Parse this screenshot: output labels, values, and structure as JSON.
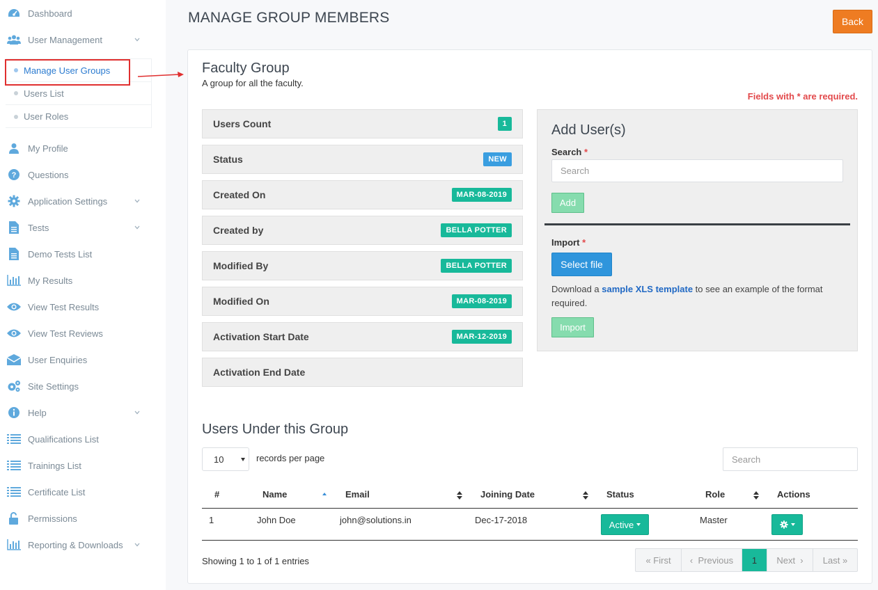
{
  "sidebar": {
    "items": [
      {
        "label": "Dashboard",
        "icon": "dashboard-icon"
      },
      {
        "label": "User Management",
        "icon": "users-icon",
        "expandable": true
      },
      {
        "label": "My Profile",
        "icon": "user-icon"
      },
      {
        "label": "Questions",
        "icon": "question-icon"
      },
      {
        "label": "Application Settings",
        "icon": "gear-icon",
        "expandable": true
      },
      {
        "label": "Tests",
        "icon": "file-icon",
        "expandable": true
      },
      {
        "label": "Demo Tests List",
        "icon": "file-icon"
      },
      {
        "label": "My Results",
        "icon": "bar-chart-icon"
      },
      {
        "label": "View Test Results",
        "icon": "eye-icon"
      },
      {
        "label": "View Test Reviews",
        "icon": "eye-icon"
      },
      {
        "label": "User Enquiries",
        "icon": "envelope-icon"
      },
      {
        "label": "Site Settings",
        "icon": "gears-icon"
      },
      {
        "label": "Help",
        "icon": "info-icon",
        "expandable": true
      },
      {
        "label": "Qualifications List",
        "icon": "list-icon"
      },
      {
        "label": "Trainings List",
        "icon": "list-icon"
      },
      {
        "label": "Certificate List",
        "icon": "list-icon"
      },
      {
        "label": "Permissions",
        "icon": "unlock-icon"
      },
      {
        "label": "Reporting & Downloads",
        "icon": "bar-chart-icon",
        "expandable": true
      }
    ],
    "submenu": [
      {
        "label": "Manage User Groups",
        "active": true
      },
      {
        "label": "Users List"
      },
      {
        "label": "User Roles"
      }
    ]
  },
  "header": {
    "title": "MANAGE GROUP MEMBERS",
    "back_label": "Back"
  },
  "group": {
    "name": "Faculty Group",
    "description": "A group for all the faculty.",
    "required_note": "Fields with * are required."
  },
  "details": [
    {
      "label": "Users Count",
      "value": "1",
      "badge_color": "#18b99a"
    },
    {
      "label": "Status",
      "value": "NEW",
      "badge_color": "#3a9ee0"
    },
    {
      "label": "Created On",
      "value": "MAR-08-2019",
      "badge_color": "#18b99a"
    },
    {
      "label": "Created by",
      "value": "BELLA POTTER",
      "badge_color": "#18b99a"
    },
    {
      "label": "Modified By",
      "value": "BELLA POTTER",
      "badge_color": "#18b99a"
    },
    {
      "label": "Modified On",
      "value": "MAR-08-2019",
      "badge_color": "#18b99a"
    },
    {
      "label": "Activation Start Date",
      "value": "MAR-12-2019",
      "badge_color": "#18b99a"
    },
    {
      "label": "Activation End Date",
      "value": ""
    }
  ],
  "add_users": {
    "title": "Add User(s)",
    "search_label": "Search",
    "required_star": "*",
    "search_placeholder": "Search",
    "add_label": "Add",
    "import_label": "Import",
    "select_file_label": "Select file",
    "download_prefix": "Download a ",
    "download_link": "sample XLS template",
    "download_suffix": " to see an example of the format required.",
    "import_button": "Import"
  },
  "users_table": {
    "title": "Users Under this Group",
    "page_length": "10",
    "length_label": "records per page",
    "search_placeholder": "Search",
    "columns": [
      "#",
      "Name",
      "Email",
      "Joining Date",
      "Status",
      "Role",
      "Actions"
    ],
    "rows": [
      {
        "num": "1",
        "name": "John Doe",
        "email": "john@solutions.in",
        "joining_date": "Dec-17-2018",
        "status": "Active",
        "role": "Master"
      }
    ],
    "info": "Showing 1 to 1 of 1 entries",
    "pagination": {
      "first": "First",
      "previous": "Previous",
      "current": "1",
      "next": "Next",
      "last": "Last"
    }
  },
  "colors": {
    "accent_teal": "#18b99a",
    "back_orange": "#ee7c22",
    "primary_blue": "#2f95dc",
    "required_red": "#e2494b"
  }
}
